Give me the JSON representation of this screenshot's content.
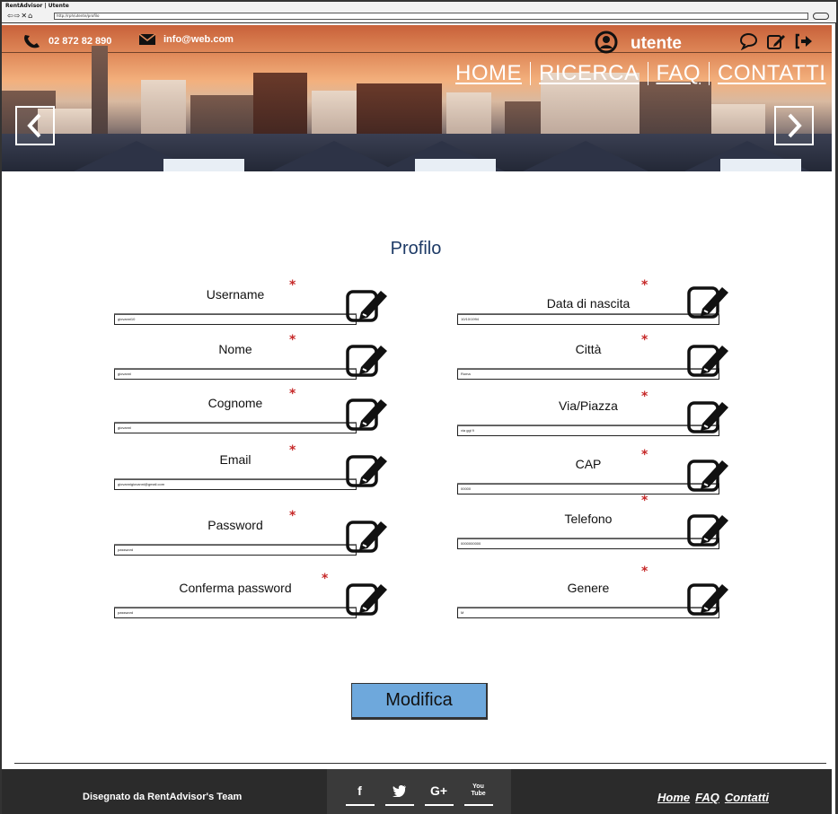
{
  "browser": {
    "title": "RentAdvisor | Utente",
    "nav_glyphs": "⇦⇨✕⌂",
    "url": "http://rph/utente/profilo"
  },
  "header": {
    "phone": "02 872 82 890",
    "email": "info@web.com",
    "user_label": "utente",
    "nav": [
      "HOME",
      "RICERCA",
      "FAQ",
      "CONTATTI"
    ],
    "icons": [
      "user-icon",
      "chat-icon",
      "edit-icon",
      "logout-icon"
    ],
    "arrow_left": "‹",
    "arrow_right": "›"
  },
  "main": {
    "title": "Profilo",
    "fields_left": [
      {
        "label": "Username",
        "value": "giovanni10"
      },
      {
        "label": "Nome",
        "value": "giovanni"
      },
      {
        "label": "Cognome",
        "value": "giovanni"
      },
      {
        "label": "Email",
        "value": "giovannigiovanni@gmail.com"
      },
      {
        "label": "Password",
        "value": "password"
      },
      {
        "label": "Conferma password",
        "value": "password"
      }
    ],
    "fields_right": [
      {
        "label": "Data di nascita",
        "value": "10/10/1994"
      },
      {
        "label": "Città",
        "value": "Roma"
      },
      {
        "label": "Via/Piazza",
        "value": "via ggl 9"
      },
      {
        "label": "CAP",
        "value": "00000"
      },
      {
        "label": "Telefono",
        "value": "0000000000"
      },
      {
        "label": "Genere",
        "value": "M"
      }
    ],
    "required_mark": "*",
    "submit_label": "Modifica"
  },
  "footer": {
    "credit": "Disegnato da RentAdvisor's Team",
    "social": [
      "f",
      "t",
      "G+",
      "You Tube"
    ],
    "links": [
      "Home",
      "FAQ",
      "Contatti"
    ]
  },
  "colors": {
    "accent_button": "#6ea8dc",
    "title": "#1d3a66",
    "required": "#c62828",
    "footer_bg": "#2b2b2b"
  }
}
